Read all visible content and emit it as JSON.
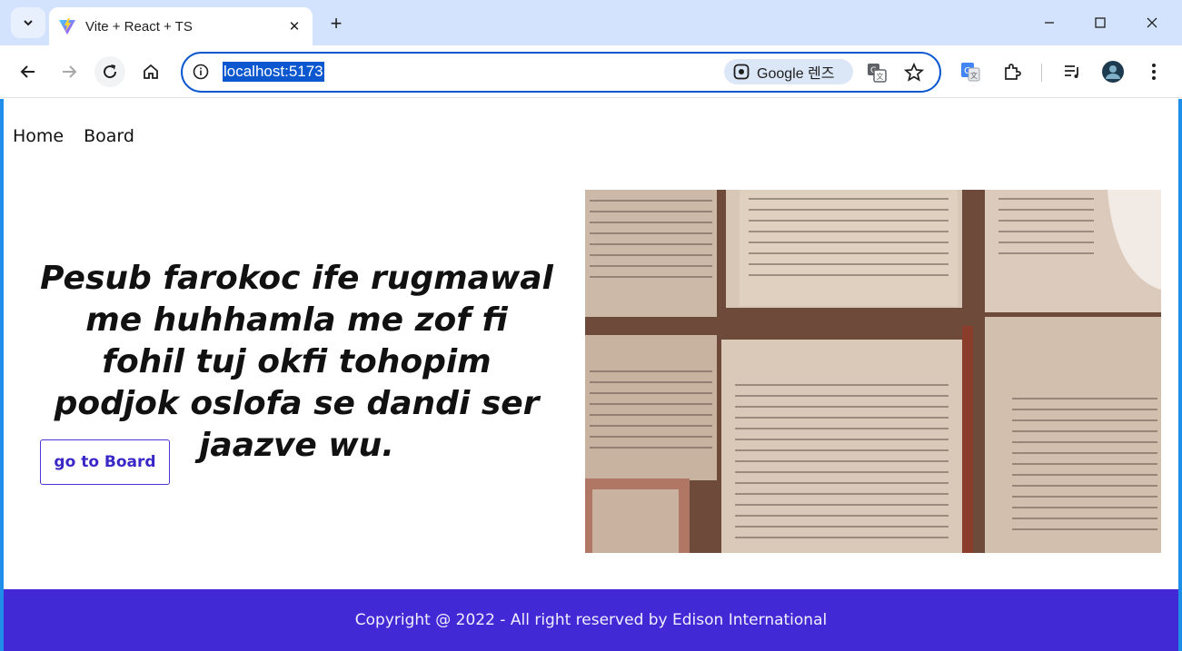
{
  "browser": {
    "tab_title": "Vite + React + TS",
    "url": "localhost:5173",
    "lens_label": "Google 렌즈",
    "accent_color": "#0b57d0"
  },
  "nav": {
    "items": [
      "Home",
      "Board"
    ]
  },
  "hero": {
    "heading": "Pesub farokoc ife rugmawal me huhhamla me zof fi fohil tuj okfi tohopim podjok oslofa se dandi ser jaazve wu.",
    "button_label": "go to Board",
    "image_subject": "open-books-photo"
  },
  "footer": {
    "text": "Copyright @ 2022 - All right reserved by Edison International",
    "color": "#4229d6"
  }
}
